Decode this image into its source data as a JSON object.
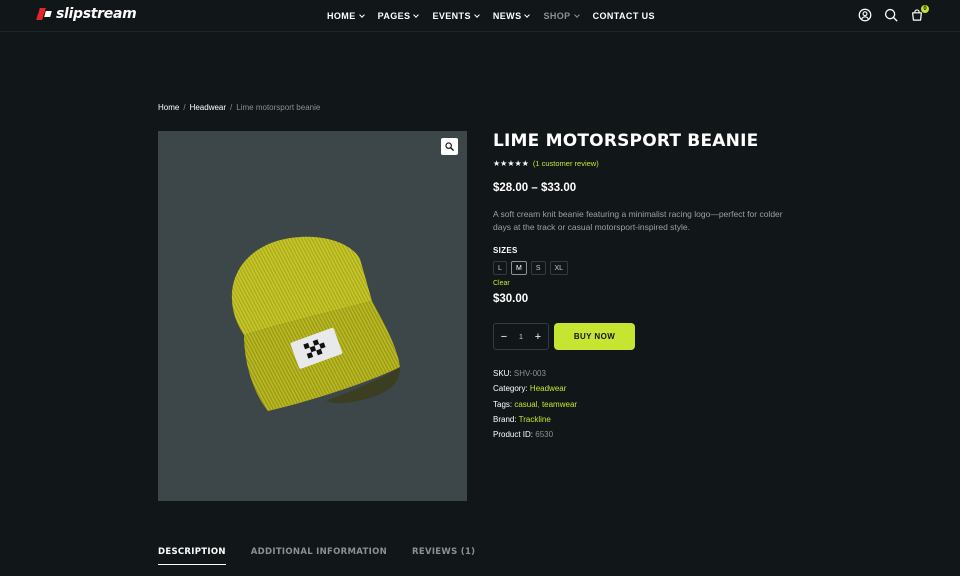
{
  "header": {
    "brand": "slipstream",
    "nav": [
      {
        "label": "HOME",
        "has_dropdown": true
      },
      {
        "label": "PAGES",
        "has_dropdown": true
      },
      {
        "label": "EVENTS",
        "has_dropdown": true
      },
      {
        "label": "NEWS",
        "has_dropdown": true
      },
      {
        "label": "SHOP",
        "has_dropdown": true
      },
      {
        "label": "CONTACT US",
        "has_dropdown": false
      }
    ],
    "icons": [
      "account-icon",
      "search-icon",
      "cart-icon"
    ],
    "cart_count": "0"
  },
  "breadcrumb": {
    "items": [
      "Home",
      "Headwear",
      "Lime motorsport beanie"
    ],
    "separator": "/"
  },
  "product": {
    "title": "LIME MOTORSPORT BEANIE",
    "rating": 5,
    "rating_stars": "★★★★★",
    "review_link": "(1 customer review)",
    "price_range": "$28.00 – $33.00",
    "description": "A soft cream knit beanie featuring a minimalist racing logo—perfect for colder days at the track or casual motorsport-inspired style.",
    "sizes_label": "SIZES",
    "sizes": [
      "L",
      "M",
      "S",
      "XL"
    ],
    "selected_size": "M",
    "clear_label": "Clear",
    "variation_price": "$30.00",
    "quantity": "1",
    "qty_minus": "−",
    "qty_plus": "+",
    "buy_label": "BUY NOW",
    "meta": {
      "sku_label": "SKU:",
      "sku": "SHV-003",
      "category_label": "Category:",
      "category": "Headwear",
      "tags_label": "Tags:",
      "tag1": "casual",
      "tag2": "teamwear",
      "brand_label": "Brand:",
      "brand": "Trackline",
      "id_label": "Product ID:",
      "id": "6530"
    }
  },
  "tabs": [
    {
      "label": "DESCRIPTION",
      "active": true
    },
    {
      "label": "ADDITIONAL INFORMATION",
      "active": false
    },
    {
      "label": "REVIEWS (1)",
      "active": false
    }
  ],
  "colors": {
    "background": "#111618",
    "accent": "#c6e531",
    "image_bg": "#3d4648",
    "beanie": "#c2c227",
    "logo_red": "#e3262b"
  }
}
